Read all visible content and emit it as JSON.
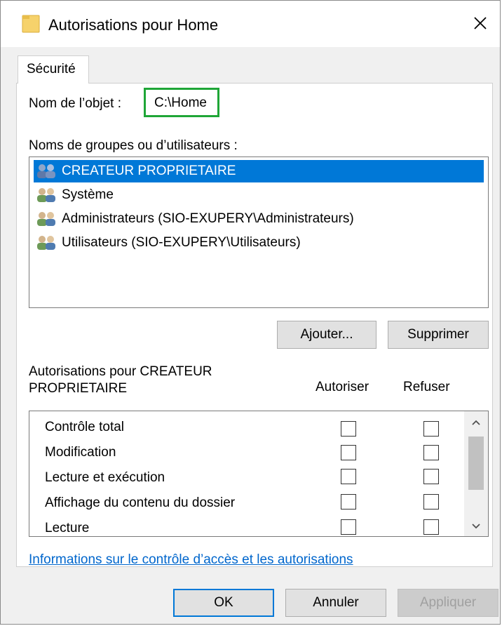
{
  "window": {
    "title": "Autorisations pour Home",
    "icon": "folder-icon",
    "close_icon": "close-icon"
  },
  "tabs": [
    {
      "label": "Sécurité",
      "selected": true
    }
  ],
  "object": {
    "label": "Nom de l’objet :",
    "value": "C:\\Home",
    "highlight_color": "#1fa637"
  },
  "groups": {
    "label": "Noms de groupes ou d’utilisateurs :",
    "items": [
      {
        "name": "CREATEUR PROPRIETAIRE",
        "selected": true
      },
      {
        "name": "Système",
        "selected": false
      },
      {
        "name": "Administrateurs (SIO-EXUPERY\\Administrateurs)",
        "selected": false
      },
      {
        "name": "Utilisateurs (SIO-EXUPERY\\Utilisateurs)",
        "selected": false
      }
    ],
    "add_button": "Ajouter...",
    "remove_button": "Supprimer"
  },
  "permissions": {
    "label_line1": "Autorisations pour CREATEUR",
    "label_line2": "PROPRIETAIRE",
    "allow_header": "Autoriser",
    "deny_header": "Refuser",
    "rows": [
      {
        "name": "Contrôle total",
        "allow": false,
        "deny": false
      },
      {
        "name": "Modification",
        "allow": false,
        "deny": false
      },
      {
        "name": "Lecture et exécution",
        "allow": false,
        "deny": false
      },
      {
        "name": "Affichage du contenu du dossier",
        "allow": false,
        "deny": false
      },
      {
        "name": "Lecture",
        "allow": false,
        "deny": false
      }
    ]
  },
  "help_link": "Informations sur le contrôle d’accès et les autorisations",
  "footer": {
    "ok": "OK",
    "cancel": "Annuler",
    "apply": "Appliquer",
    "apply_enabled": false
  },
  "colors": {
    "selection": "#0078d7",
    "link": "#0066cc",
    "folder": "#f6d26b"
  }
}
